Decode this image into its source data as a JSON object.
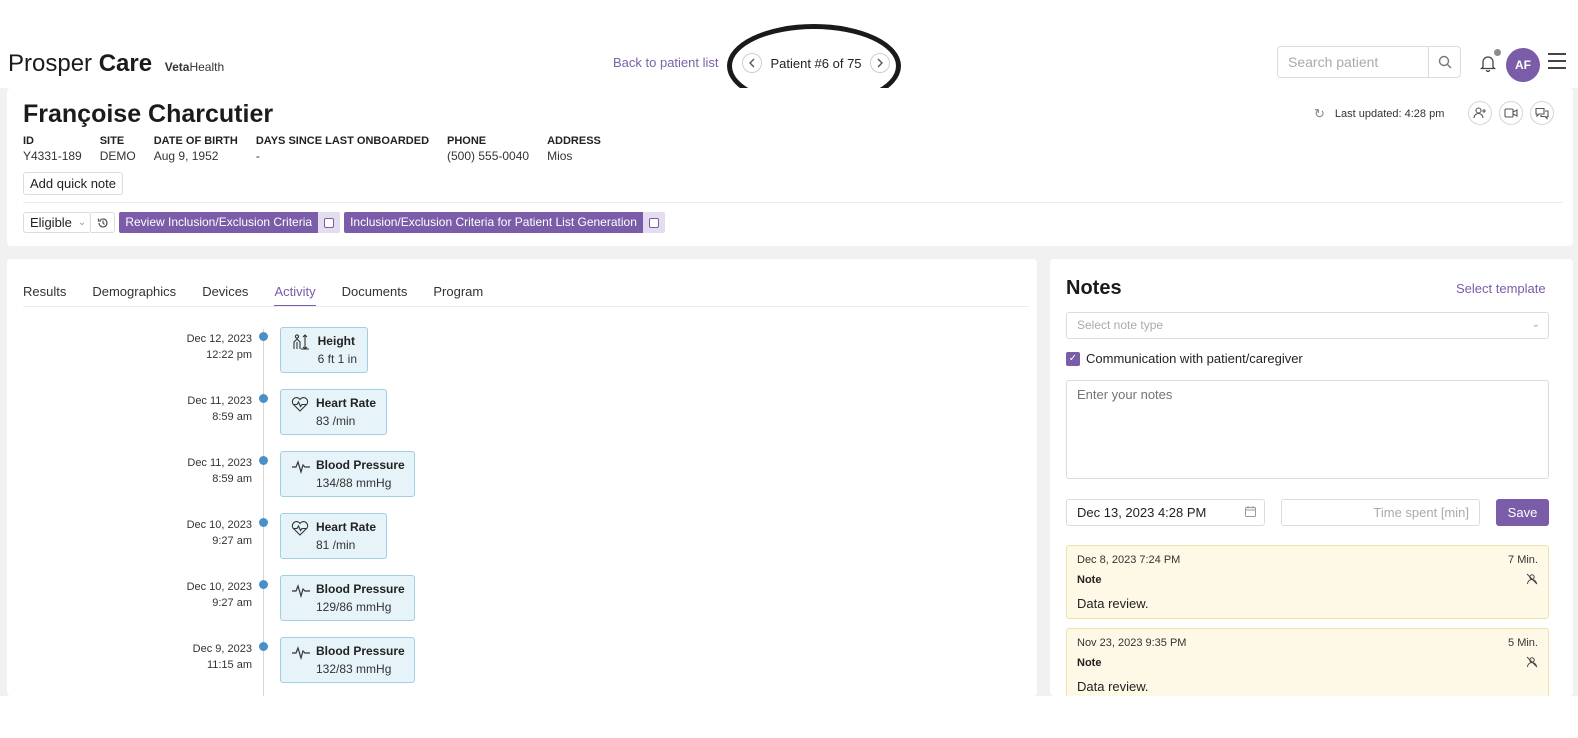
{
  "header": {
    "brand_main": "Prosper",
    "brand_bold": "Care",
    "brand_sub_bold": "Veta",
    "brand_sub": "Health",
    "back_link": "Back to patient list",
    "pager_label": "Patient #6 of 75",
    "search_placeholder": "Search patient",
    "avatar_initials": "AF"
  },
  "patient": {
    "name": "Françoise Charcutier",
    "fields": [
      {
        "key": "ID",
        "value": "Y4331-189"
      },
      {
        "key": "SITE",
        "value": "DEMO"
      },
      {
        "key": "DATE OF BIRTH",
        "value": "Aug 9, 1952"
      },
      {
        "key": "DAYS SINCE LAST ONBOARDED",
        "value": "-"
      },
      {
        "key": "PHONE",
        "value": "(500) 555-0040"
      },
      {
        "key": "ADDRESS",
        "value": "Mios"
      }
    ],
    "quick_note_label": "Add quick note",
    "status": "Eligible",
    "tags": [
      "Review Inclusion/Exclusion Criteria",
      "Inclusion/Exclusion Criteria for Patient List Generation"
    ],
    "last_updated": "Last updated: 4:28 pm"
  },
  "tabs": [
    "Results",
    "Demographics",
    "Devices",
    "Activity",
    "Documents",
    "Program"
  ],
  "active_tab": "Activity",
  "activity": [
    {
      "date": "Dec 12, 2023",
      "time": "12:22 pm",
      "title": "Height",
      "value": "6 ft 1 in",
      "icon": "height-icon"
    },
    {
      "date": "Dec 11, 2023",
      "time": "8:59 am",
      "title": "Heart Rate",
      "value": "83 /min",
      "icon": "heart-rate-icon"
    },
    {
      "date": "Dec 11, 2023",
      "time": "8:59 am",
      "title": "Blood Pressure",
      "value": "134/88 mmHg",
      "icon": "blood-pressure-icon"
    },
    {
      "date": "Dec 10, 2023",
      "time": "9:27 am",
      "title": "Heart Rate",
      "value": "81 /min",
      "icon": "heart-rate-icon"
    },
    {
      "date": "Dec 10, 2023",
      "time": "9:27 am",
      "title": "Blood Pressure",
      "value": "129/86 mmHg",
      "icon": "blood-pressure-icon"
    },
    {
      "date": "Dec 9, 2023",
      "time": "11:15 am",
      "title": "Blood Pressure",
      "value": "132/83 mmHg",
      "icon": "blood-pressure-icon"
    }
  ],
  "notes": {
    "title": "Notes",
    "select_template": "Select template",
    "note_type_placeholder": "Select note type",
    "communication_label": "Communication with patient/caregiver",
    "notes_placeholder": "Enter your notes",
    "date_value": "Dec 13, 2023 4:28 PM",
    "time_placeholder": "Time spent [min]",
    "save_label": "Save",
    "history": [
      {
        "date": "Dec 8, 2023 7:24 PM",
        "minutes": "7 Min.",
        "type": "Note",
        "body": "Data review."
      },
      {
        "date": "Nov 23, 2023 9:35 PM",
        "minutes": "5 Min.",
        "type": "Note",
        "body": "Data review."
      }
    ]
  },
  "colors": {
    "accent": "#7a5ca8",
    "card_blue": "#e6f3f9",
    "note_yellow": "#fdf9e6"
  }
}
